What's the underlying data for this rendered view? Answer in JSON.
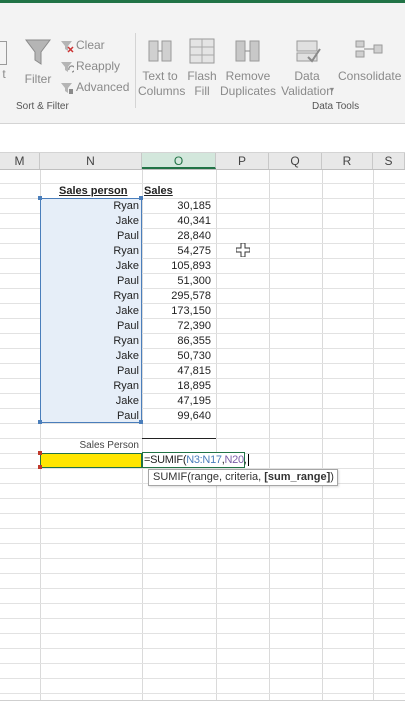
{
  "ribbon": {
    "filter_label": "Filter",
    "clear_label": "Clear",
    "reapply_label": "Reapply",
    "advanced_label": "Advanced",
    "text_to_columns_label": "Text to\nColumns",
    "flash_fill_label": "Flash\nFill",
    "remove_duplicates_label": "Remove\nDuplicates",
    "data_validation_label": "Data\nValidation",
    "consolidate_label": "Consolidate",
    "group_sort_filter": "Sort & Filter",
    "group_data_tools": "Data Tools"
  },
  "columns": [
    "M",
    "N",
    "O",
    "P",
    "Q",
    "R",
    "S"
  ],
  "table": {
    "header_salesperson": "Sales person",
    "header_sales": "Sales",
    "rows": [
      {
        "name": "Ryan",
        "sales": "30,185"
      },
      {
        "name": "Jake",
        "sales": "40,341"
      },
      {
        "name": "Paul",
        "sales": "28,840"
      },
      {
        "name": "Ryan",
        "sales": "54,275"
      },
      {
        "name": "Jake",
        "sales": "105,893"
      },
      {
        "name": "Paul",
        "sales": "51,300"
      },
      {
        "name": "Ryan",
        "sales": "295,578"
      },
      {
        "name": "Jake",
        "sales": "173,150"
      },
      {
        "name": "Paul",
        "sales": "72,390"
      },
      {
        "name": "Ryan",
        "sales": "86,355"
      },
      {
        "name": "Jake",
        "sales": "50,730"
      },
      {
        "name": "Paul",
        "sales": "47,815"
      },
      {
        "name": "Ryan",
        "sales": "18,895"
      },
      {
        "name": "Jake",
        "sales": "47,195"
      },
      {
        "name": "Paul",
        "sales": "99,640"
      }
    ]
  },
  "criteria_label": "Sales Person",
  "formula": {
    "prefix": "=SUMIF(",
    "range_ref": "N3:N17",
    "sep": ",",
    "criteria_ref": "N20",
    "suffix": ","
  },
  "tooltip": {
    "text": "SUMIF(range, criteria, ",
    "bold_arg": "[sum_range]",
    "close": ")"
  },
  "colors": {
    "accent": "#217346",
    "highlight_yellow": "#ffe600",
    "range_blue": "#4a7ebb",
    "range_fill": "#e6eef8",
    "criteria_ref": "#7b5ea7"
  }
}
